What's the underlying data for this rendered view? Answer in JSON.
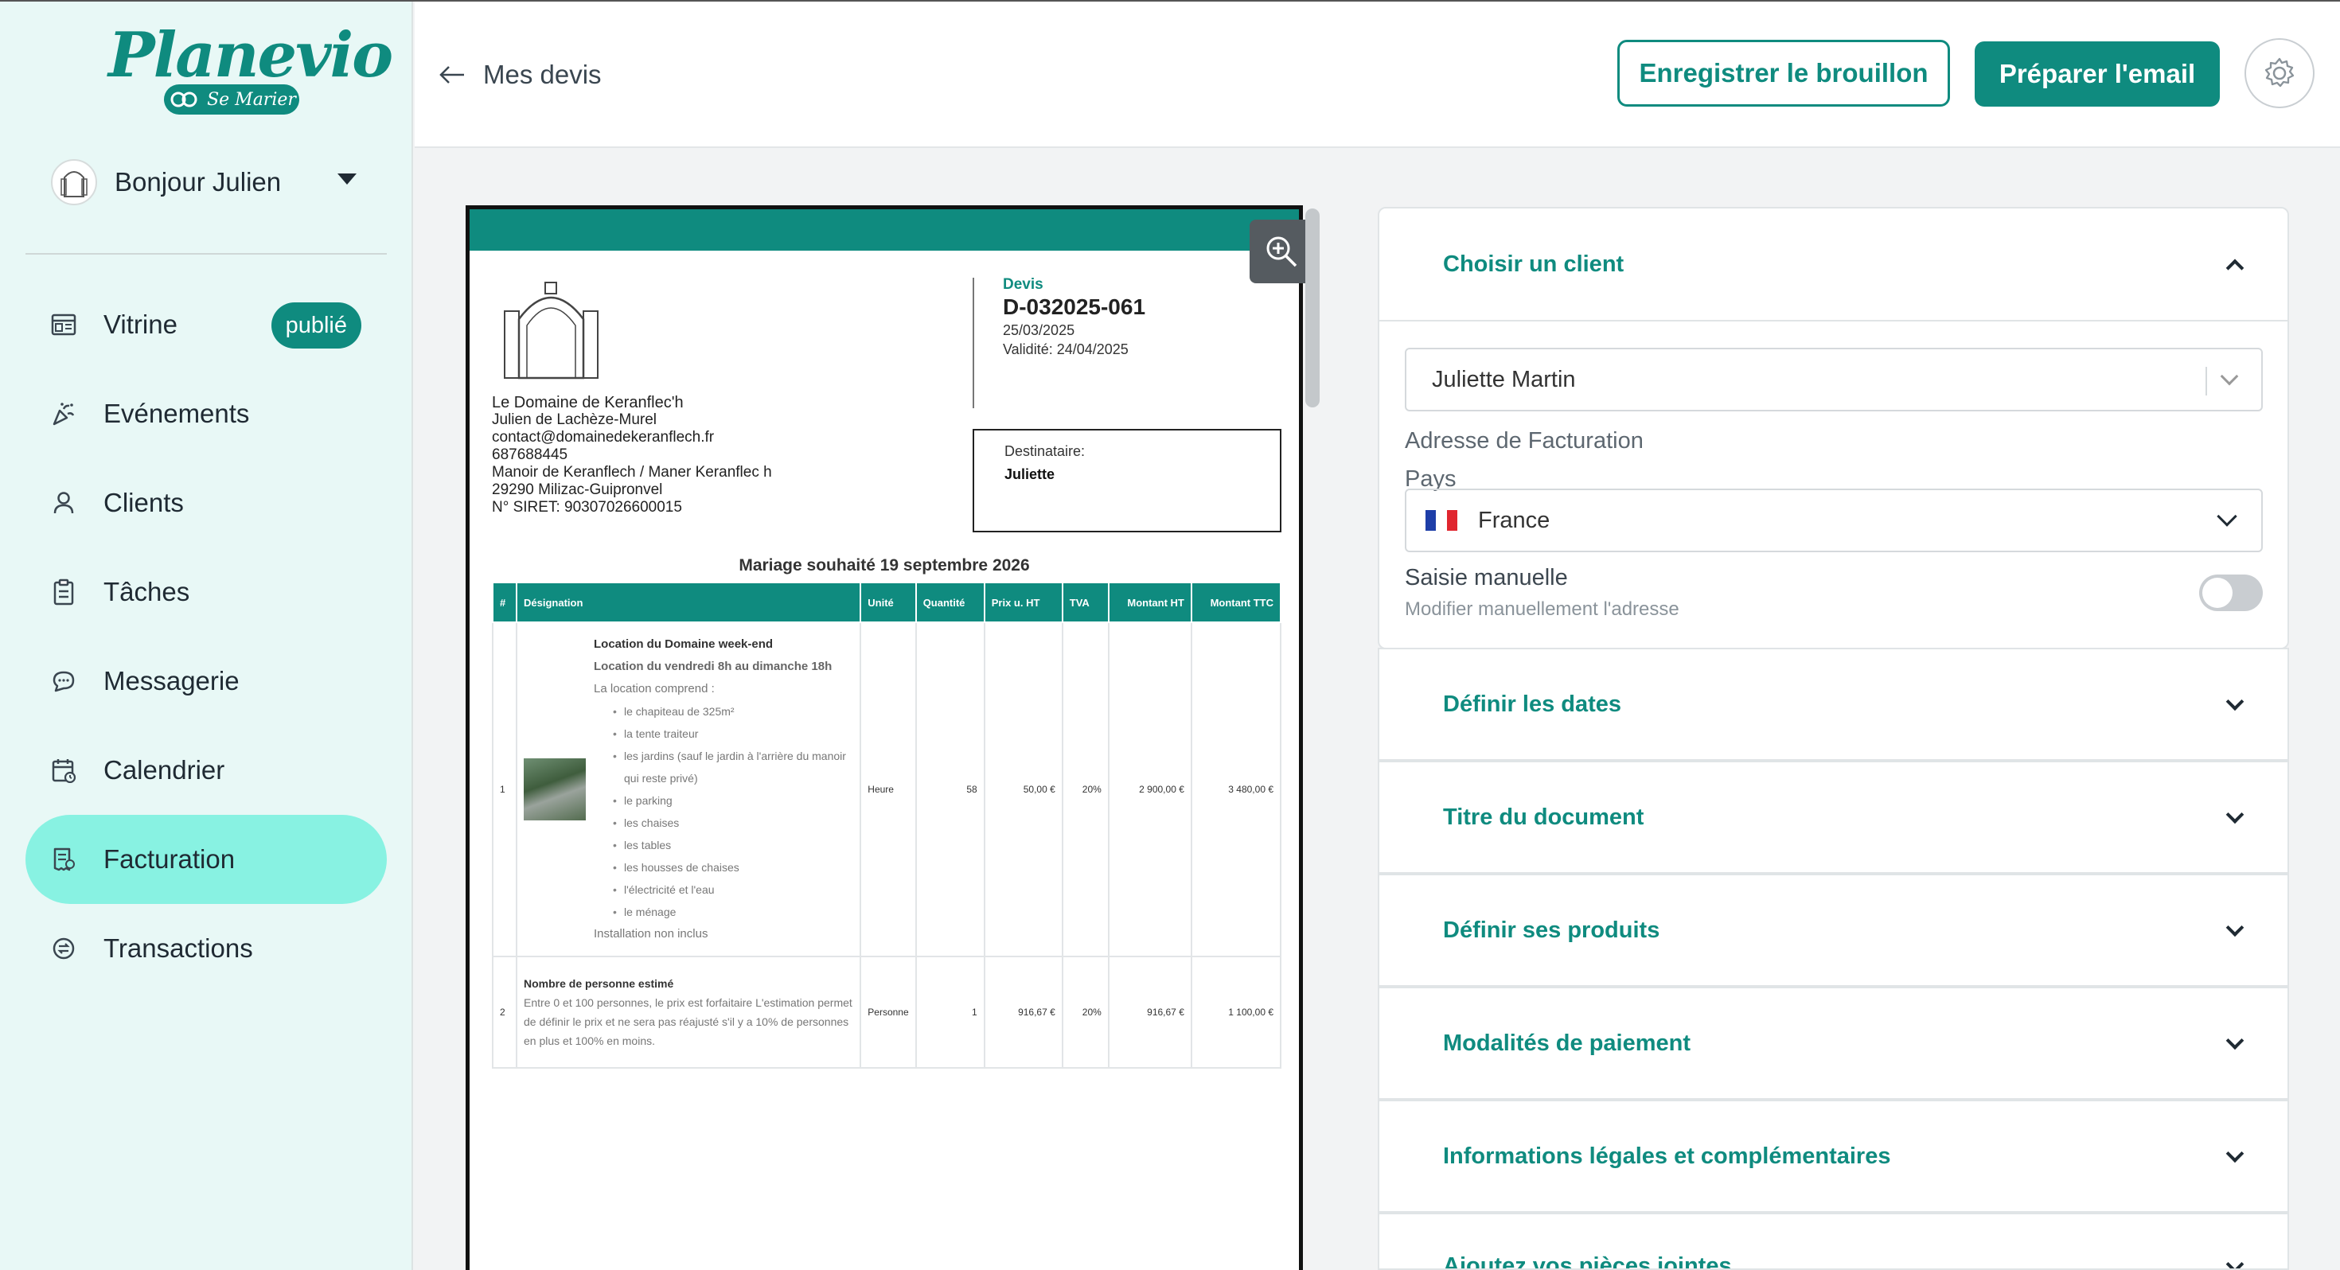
{
  "brand": {
    "name": "Planevio",
    "sub": "Se Marier"
  },
  "user": {
    "greeting": "Bonjour Julien"
  },
  "sidebar": {
    "items": [
      {
        "label": "Vitrine",
        "icon": "storefront-icon",
        "badge": "publié"
      },
      {
        "label": "Evénements",
        "icon": "party-popper-icon"
      },
      {
        "label": "Clients",
        "icon": "user-icon"
      },
      {
        "label": "Tâches",
        "icon": "clipboard-icon"
      },
      {
        "label": "Messagerie",
        "icon": "chat-icon"
      },
      {
        "label": "Calendrier",
        "icon": "calendar-icon"
      },
      {
        "label": "Facturation",
        "icon": "invoice-icon",
        "active": true
      },
      {
        "label": "Transactions",
        "icon": "exchange-icon"
      }
    ]
  },
  "header": {
    "back_label": "Mes devis",
    "save_draft": "Enregistrer le brouillon",
    "prepare_email": "Préparer l'email"
  },
  "document": {
    "company": {
      "name": "Le Domaine de Keranflec'h",
      "contact": "Julien de Lachèze-Murel",
      "email": "contact@domainedekeranflech.fr",
      "phone": "687688445",
      "address1": "Manoir de Keranflech / Maner Keranflec h",
      "address2": "29290 Milizac-Guipronvel",
      "siret": "N° SIRET: 90307026600015"
    },
    "type": "Devis",
    "number": "D-032025-061",
    "date": "25/03/2025",
    "validity": "Validité: 24/04/2025",
    "recipient_label": "Destinataire:",
    "recipient": "Juliette",
    "title": "Mariage souhaité 19 septembre 2026",
    "columns": [
      "#",
      "Désignation",
      "Unité",
      "Quantité",
      "Prix u. HT",
      "TVA",
      "Montant HT",
      "Montant TTC"
    ],
    "rows": [
      {
        "num": "1",
        "title": "Location du Domaine week-end",
        "subtitle": "Location du vendredi 8h au dimanche 18h",
        "intro": "La location comprend :",
        "items": [
          "le chapiteau de 325m²",
          "la tente traiteur",
          "les jardins (sauf le jardin à l'arrière du manoir qui reste privé)",
          "le parking",
          "les chaises",
          "les tables",
          "les housses de chaises",
          "l'électricité et l'eau",
          "le ménage"
        ],
        "footer": "Installation non inclus",
        "unit": "Heure",
        "qty": "58",
        "price": "50,00 €",
        "tva": "20%",
        "ht": "2 900,00 €",
        "ttc": "3 480,00 €"
      },
      {
        "num": "2",
        "title": "Nombre de personne estimé",
        "text": "Entre 0 et 100 personnes, le prix est forfaitaire L'estimation permet de définir le prix et ne sera pas réajusté s'il y a 10% de personnes en plus et 100% en moins.",
        "unit": "Personne",
        "qty": "1",
        "price": "916,67 €",
        "tva": "20%",
        "ht": "916,67 €",
        "ttc": "1 100,00 €"
      }
    ]
  },
  "panel": {
    "client_section": "Choisir un client",
    "client_value": "Juliette Martin",
    "billing_address_label": "Adresse de Facturation",
    "country_label": "Pays",
    "country_value": "France",
    "manual_label": "Saisie manuelle",
    "manual_sub": "Modifier manuellement l'adresse",
    "manual_on": false,
    "sections": [
      "Définir les dates",
      "Titre du document",
      "Définir ses produits",
      "Modalités de paiement",
      "Informations légales et complémentaires",
      "Ajoutez vos pièces jointes"
    ]
  },
  "colors": {
    "primary": "#0f8b7f",
    "active_nav": "#88f2e2",
    "sidebar_bg": "#e8f8f6"
  }
}
